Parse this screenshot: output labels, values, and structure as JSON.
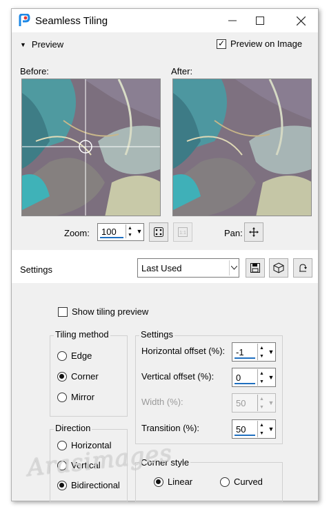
{
  "window": {
    "title": "Seamless Tiling",
    "minimize_icon": "minimize-icon",
    "maximize_icon": "maximize-icon",
    "close_icon": "close-icon"
  },
  "preview": {
    "section_label": "Preview",
    "preview_on_image_label": "Preview on Image",
    "preview_on_image_checked": true,
    "before_label": "Before:",
    "after_label": "After:",
    "zoom_label": "Zoom:",
    "zoom_value": "100",
    "pan_label": "Pan:"
  },
  "settings_bar": {
    "label": "Settings",
    "preset_value": "Last Used"
  },
  "show_tiling_preview": {
    "label": "Show tiling preview",
    "checked": false
  },
  "tiling_method": {
    "title": "Tiling method",
    "options": [
      "Edge",
      "Corner",
      "Mirror"
    ],
    "selected": "Corner"
  },
  "direction": {
    "title": "Direction",
    "options": [
      "Horizontal",
      "Vertical",
      "Bidirectional"
    ],
    "selected": "Bidirectional"
  },
  "settings_group": {
    "title": "Settings",
    "horizontal_offset": {
      "label": "Horizontal offset (%):",
      "value": "-1"
    },
    "vertical_offset": {
      "label": "Vertical offset (%):",
      "value": "0"
    },
    "width": {
      "label": "Width (%):",
      "value": "50",
      "disabled": true
    },
    "transition": {
      "label": "Transition (%):",
      "value": "50"
    }
  },
  "corner_style": {
    "title": "Corner style",
    "options": [
      "Linear",
      "Curved"
    ],
    "selected": "Linear"
  },
  "watermark": "Arasimages",
  "colors": {
    "accent": "#1e6fc0",
    "window_bg": "#f0f0f0"
  }
}
